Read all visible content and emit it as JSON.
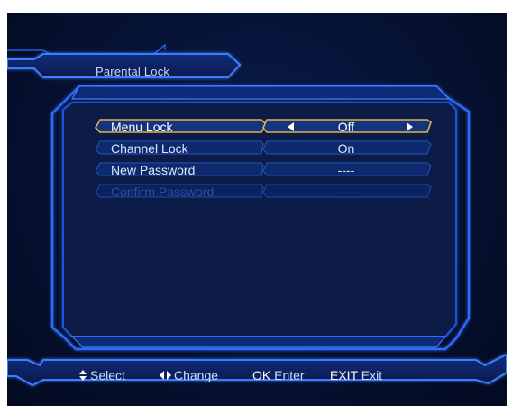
{
  "title": "Parental Lock",
  "menu": {
    "items": [
      {
        "label": "Menu Lock",
        "value": "Off",
        "state": "selected"
      },
      {
        "label": "Channel Lock",
        "value": "On",
        "state": "normal"
      },
      {
        "label": "New Password",
        "value": "----",
        "state": "normal"
      },
      {
        "label": "Confirm Password",
        "value": "----",
        "state": "disabled"
      }
    ]
  },
  "footer": {
    "select": {
      "key": "",
      "label": "Select",
      "icon": "up-down-arrows-icon"
    },
    "change": {
      "key": "",
      "label": "Change",
      "icon": "left-right-arrows-icon"
    },
    "enter": {
      "key": "OK",
      "label": "Enter"
    },
    "exit": {
      "key": "EXIT",
      "label": "Exit"
    }
  },
  "colors": {
    "frame": "#2d6bff",
    "highlight": "#e3b24a",
    "background": "#061233"
  }
}
